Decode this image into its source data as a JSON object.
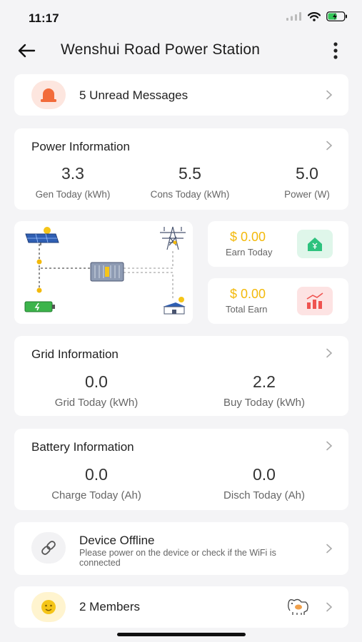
{
  "status_bar": {
    "time": "11:17"
  },
  "nav": {
    "title": "Wenshui Road Power Station"
  },
  "messages": {
    "label": "5 Unread Messages"
  },
  "power_info": {
    "title": "Power Information",
    "stats": [
      {
        "value": "3.3",
        "label": "Gen Today (kWh)"
      },
      {
        "value": "5.5",
        "label": "Cons Today (kWh)"
      },
      {
        "value": "5.0",
        "label": "Power (W)"
      }
    ]
  },
  "earnings": {
    "today": {
      "value": "$ 0.00",
      "label": "Earn Today"
    },
    "total": {
      "value": "$ 0.00",
      "label": "Total Earn"
    }
  },
  "grid_info": {
    "title": "Grid Information",
    "stats": [
      {
        "value": "0.0",
        "label": "Grid Today (kWh)"
      },
      {
        "value": "2.2",
        "label": "Buy Today (kWh)"
      }
    ]
  },
  "battery_info": {
    "title": "Battery Information",
    "stats": [
      {
        "value": "0.0",
        "label": "Charge Today (Ah)"
      },
      {
        "value": "0.0",
        "label": "Disch Today (Ah)"
      }
    ]
  },
  "device": {
    "title": "Device Offline",
    "description": "Please power on the device or check if the WiFi is connected"
  },
  "members": {
    "label": "2 Members"
  },
  "colors": {
    "accent_yellow": "#f3b90b",
    "earn_icon_bg": "#dff6ea",
    "earn_icon_fg": "#2ec27e",
    "total_icon_bg": "#fde3e3",
    "total_icon_fg": "#ef5350",
    "message_icon": "#f26b3a"
  },
  "icons": [
    "back-arrow-icon",
    "more-vertical-icon",
    "alarm-light-icon",
    "chevron-right-icon",
    "home-yen-icon",
    "chart-up-icon",
    "link-icon",
    "smiley-icon",
    "pet-icon",
    "solar-panel-icon",
    "transmission-tower-icon",
    "battery-icon",
    "inverter-icon",
    "house-solar-icon",
    "wifi-icon"
  ]
}
